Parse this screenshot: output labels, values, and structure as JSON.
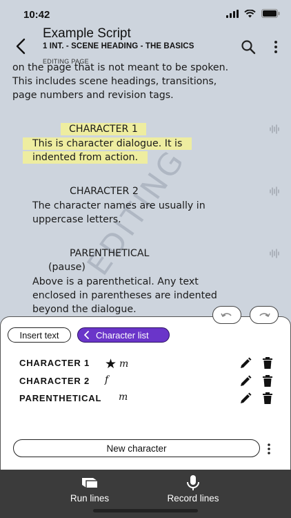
{
  "status_bar": {
    "time": "10:42"
  },
  "header": {
    "title": "Example Script",
    "subtitle": "1 INT. - SCENE HEADING - THE BASICS",
    "mode": "EDITING PAGE"
  },
  "script": {
    "intro_lines": [
      "on the page that is not meant to be spoken.",
      "This includes scene headings, transitions,",
      "page numbers and revision tags."
    ],
    "block1": {
      "character": "CHARACTER 1",
      "dialogue": [
        "This is character dialogue. It is",
        "indented from action."
      ]
    },
    "block2": {
      "character": "CHARACTER 2",
      "dialogue": [
        "The character names are usually in",
        "uppercase letters."
      ]
    },
    "block3": {
      "character": "PARENTHETICAL",
      "parenthetical": "(pause)",
      "dialogue": [
        "Above is a parenthetical. Any text",
        "enclosed in parentheses are indented",
        "beyond the dialogue."
      ]
    },
    "watermark": "EDITING"
  },
  "sheet": {
    "insert_text_label": "Insert text",
    "character_list_label": "Character list",
    "characters": [
      {
        "name": "CHARACTER 1",
        "tags": [
          "★",
          "m"
        ]
      },
      {
        "name": "CHARACTER 2",
        "tags": [
          "f"
        ]
      },
      {
        "name": "PARENTHETICAL",
        "tags": [
          "m"
        ]
      }
    ],
    "new_character_label": "New character"
  },
  "bottom_nav": {
    "run_lines_label": "Run lines",
    "record_lines_label": "Record lines"
  },
  "colors": {
    "accent": "#6a35c9",
    "highlight": "#eeeda0",
    "background": "#cdd4dd",
    "bottom_bar": "#3b3b3b"
  }
}
